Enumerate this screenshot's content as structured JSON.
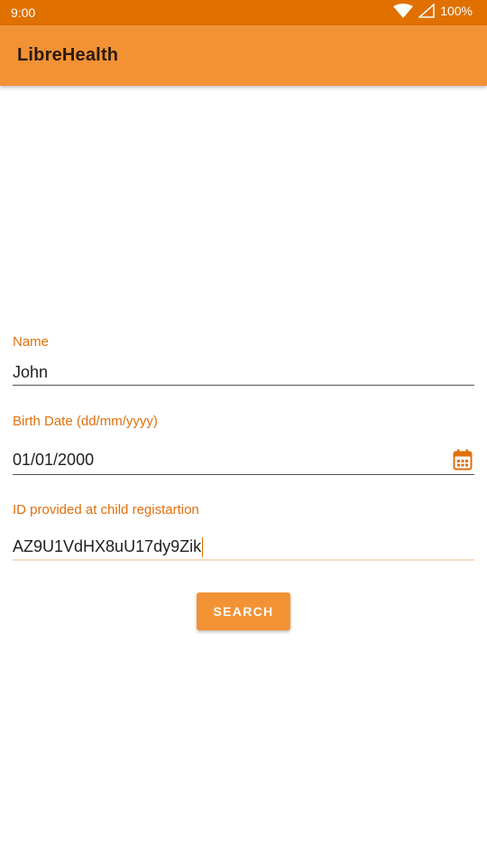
{
  "status_bar": {
    "time": "9:00",
    "battery": "100%"
  },
  "app_bar": {
    "title": "LibreHealth"
  },
  "form": {
    "name": {
      "label": "Name",
      "value": "John"
    },
    "birth_date": {
      "label": "Birth Date (dd/mm/yyyy)",
      "value": "01/01/2000"
    },
    "child_id": {
      "label": "ID provided at child registartion",
      "value": "AZ9U1VdHX8uU17dy9Zik"
    },
    "search_label": "SEARCH"
  },
  "colors": {
    "status_bar": "#e07000",
    "app_bar": "#f39235",
    "accent": "#e0700c"
  },
  "icons": [
    "wifi-icon",
    "signal-icon",
    "calendar-icon"
  ]
}
